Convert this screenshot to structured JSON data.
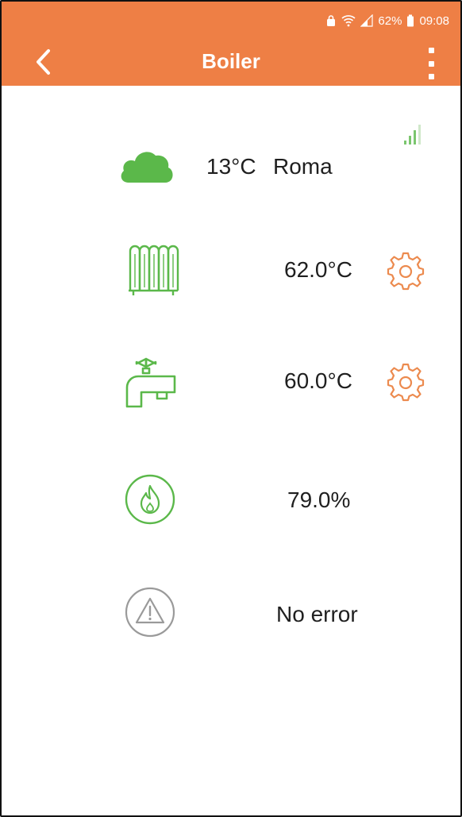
{
  "status_bar": {
    "battery_percent": "62%",
    "time": "09:08"
  },
  "header": {
    "title": "Boiler",
    "back_icon": "chevron-left-icon",
    "menu_icon": "more-vert-icon"
  },
  "weather": {
    "temperature": "13°C",
    "city": "Roma",
    "icon": "cloud-icon"
  },
  "signal": {
    "icon": "signal-strength-icon",
    "bars": 4
  },
  "heating": {
    "icon": "radiator-icon",
    "value": "62.0°C",
    "settings_icon": "gear-icon"
  },
  "hot_water": {
    "icon": "faucet-icon",
    "value": "60.0°C",
    "settings_icon": "gear-icon"
  },
  "flame": {
    "icon": "flame-icon",
    "value": "79.0%"
  },
  "error": {
    "icon": "warning-icon",
    "value": "No error"
  },
  "colors": {
    "accent": "#ee7f45",
    "green": "#5bb84a",
    "gear": "#ec8a4e",
    "grey": "#9a9a9a"
  }
}
